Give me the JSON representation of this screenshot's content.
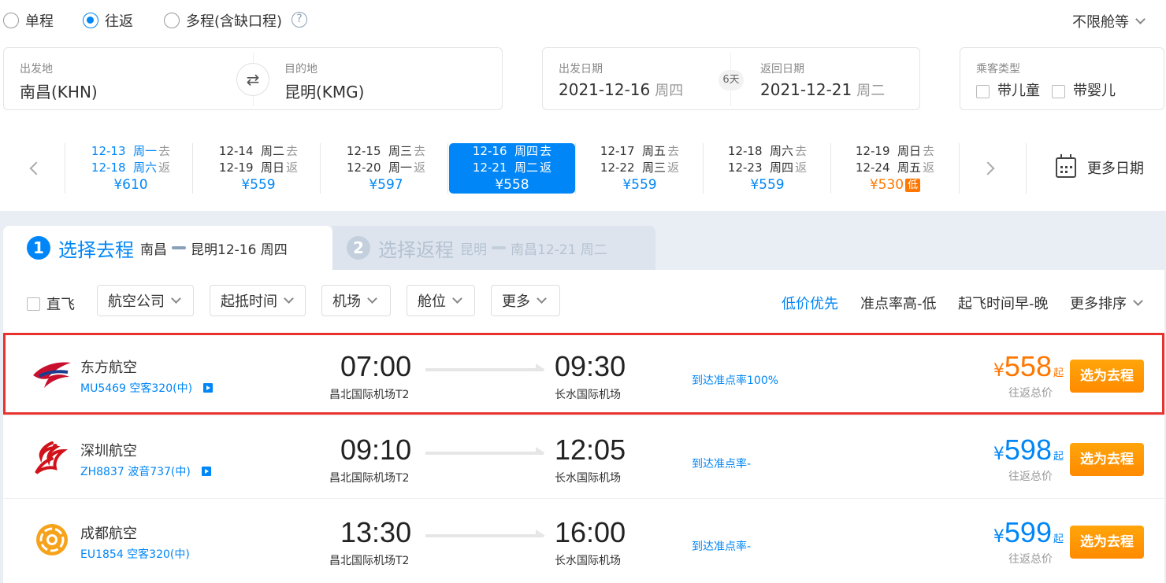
{
  "trip_type": {
    "options": [
      {
        "label": "单程",
        "checked": false
      },
      {
        "label": "往返",
        "checked": true
      },
      {
        "label": "多程(含缺口程)",
        "checked": false
      }
    ],
    "help_icon": "?",
    "cabin_label": "不限舱等"
  },
  "search": {
    "from_label": "出发地",
    "from_value": "南昌(KHN)",
    "to_label": "目的地",
    "to_value": "昆明(KMG)",
    "swap_icon": "⇄",
    "depart_label": "出发日期",
    "depart_date": "2021-12-16",
    "depart_weekday": "周四",
    "days": "6天",
    "return_label": "返回日期",
    "return_date": "2021-12-21",
    "return_weekday": "周二",
    "passenger_label": "乘客类型",
    "with_child": "带儿童",
    "with_infant": "带婴儿"
  },
  "date_strip": {
    "cells": [
      {
        "go": "12-13",
        "go_wk": "周一",
        "go_tag": "去",
        "ret": "12-18",
        "ret_wk": "周六",
        "ret_tag": "返",
        "price": "¥610",
        "style": "blue"
      },
      {
        "go": "12-14",
        "go_wk": "周二",
        "go_tag": "去",
        "ret": "12-19",
        "ret_wk": "周日",
        "ret_tag": "返",
        "price": "¥559",
        "style": "normal"
      },
      {
        "go": "12-15",
        "go_wk": "周三",
        "go_tag": "去",
        "ret": "12-20",
        "ret_wk": "周一",
        "ret_tag": "返",
        "price": "¥597",
        "style": "normal"
      },
      {
        "go": "12-16",
        "go_wk": "周四",
        "go_tag": "去",
        "ret": "12-21",
        "ret_wk": "周二",
        "ret_tag": "返",
        "price": "¥558",
        "style": "selected"
      },
      {
        "go": "12-17",
        "go_wk": "周五",
        "go_tag": "去",
        "ret": "12-22",
        "ret_wk": "周三",
        "ret_tag": "返",
        "price": "¥559",
        "style": "normal"
      },
      {
        "go": "12-18",
        "go_wk": "周六",
        "go_tag": "去",
        "ret": "12-23",
        "ret_wk": "周四",
        "ret_tag": "返",
        "price": "¥559",
        "style": "normal"
      },
      {
        "go": "12-19",
        "go_wk": "周日",
        "go_tag": "去",
        "ret": "12-24",
        "ret_wk": "周五",
        "ret_tag": "返",
        "price": "¥530",
        "style": "low",
        "badge": "低"
      }
    ],
    "more_dates": "更多日期"
  },
  "tabs": {
    "step1_num": "1",
    "step1_title": "选择去程",
    "step1_from": "南昌",
    "step1_to": "昆明12-16 周四",
    "step2_num": "2",
    "step2_title": "选择返程",
    "step2_from": "昆明",
    "step2_to": "南昌12-21 周二"
  },
  "filters": {
    "direct": "直飞",
    "buttons": [
      "航空公司",
      "起抵时间",
      "机场",
      "舱位",
      "更多"
    ],
    "sorts": [
      "低价优先",
      "准点率高-低",
      "起飞时间早-晚",
      "更多排序"
    ]
  },
  "flights": [
    {
      "airline": "东方航空",
      "flight_no": "MU5469 空客320(中)",
      "has_play": true,
      "dep_time": "07:00",
      "dep_airport": "昌北国际机场T2",
      "arr_time": "09:30",
      "arr_airport": "长水国际机场",
      "ontime": "到达准点率100%",
      "currency": "¥",
      "price": "558",
      "qi": "起",
      "total": "往返总价",
      "button": "选为去程",
      "logo": "china-eastern-logo",
      "highlight": true
    },
    {
      "airline": "深圳航空",
      "flight_no": "ZH8837 波音737(中)",
      "has_play": true,
      "dep_time": "09:10",
      "dep_airport": "昌北国际机场T2",
      "arr_time": "12:05",
      "arr_airport": "长水国际机场",
      "ontime": "到达准点率-",
      "currency": "¥",
      "price": "598",
      "qi": "起",
      "total": "往返总价",
      "button": "选为去程",
      "logo": "shenzhen-airlines-logo",
      "highlight": false
    },
    {
      "airline": "成都航空",
      "flight_no": "EU1854 空客320(中)",
      "has_play": false,
      "dep_time": "13:30",
      "dep_airport": "昌北国际机场T2",
      "arr_time": "16:00",
      "arr_airport": "长水国际机场",
      "ontime": "到达准点率-",
      "currency": "¥",
      "price": "599",
      "qi": "起",
      "total": "往返总价",
      "button": "选为去程",
      "logo": "chengdu-airlines-logo",
      "highlight": false
    }
  ],
  "colors": {
    "accent": "#0086f6",
    "orange": "#ff7700",
    "highlight_border": "#e8322e"
  }
}
